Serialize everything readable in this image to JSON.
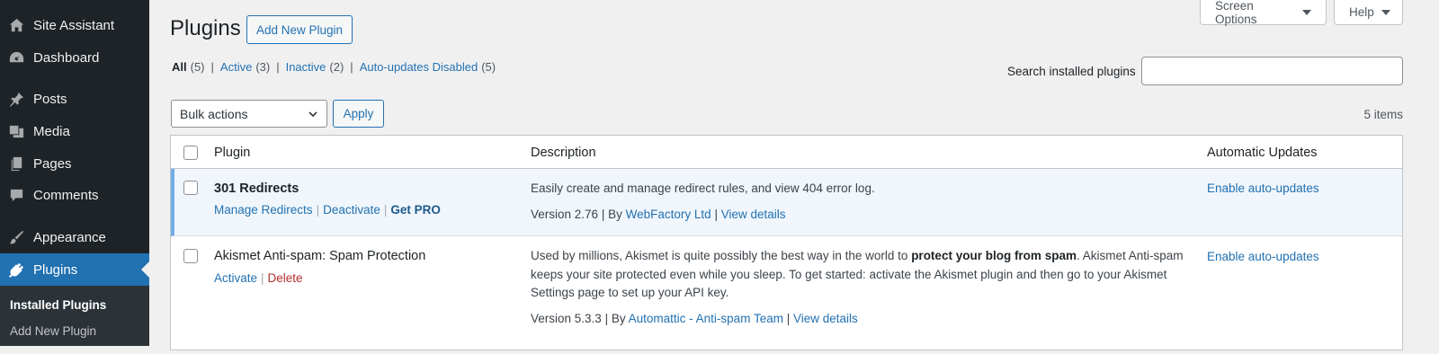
{
  "sidebar": {
    "items": [
      {
        "label": "Site Assistant",
        "icon": "house-icon"
      },
      {
        "label": "Dashboard",
        "icon": "dashboard-icon"
      },
      {
        "label": "Posts",
        "icon": "pushpin-icon"
      },
      {
        "label": "Media",
        "icon": "media-icon"
      },
      {
        "label": "Pages",
        "icon": "pages-icon"
      },
      {
        "label": "Comments",
        "icon": "comment-icon"
      },
      {
        "label": "Appearance",
        "icon": "brush-icon"
      },
      {
        "label": "Plugins",
        "icon": "plugin-icon"
      }
    ],
    "submenu": [
      "Installed Plugins",
      "Add New Plugin"
    ]
  },
  "header": {
    "title": "Plugins",
    "add_new": "Add New Plugin",
    "screen_options": "Screen Options",
    "help": "Help"
  },
  "filters": [
    {
      "label": "All",
      "count": "(5)"
    },
    {
      "label": "Active",
      "count": "(3)"
    },
    {
      "label": "Inactive",
      "count": "(2)"
    },
    {
      "label": "Auto-updates Disabled",
      "count": "(5)"
    }
  ],
  "search": {
    "label": "Search installed plugins",
    "value": ""
  },
  "bulk": {
    "selected": "Bulk actions",
    "apply": "Apply"
  },
  "items_count": "5 items",
  "table": {
    "headers": {
      "plugin": "Plugin",
      "description": "Description",
      "auto": "Automatic Updates"
    },
    "rows": [
      {
        "name": "301 Redirects",
        "actions": [
          "Manage Redirects",
          "Deactivate",
          "Get PRO"
        ],
        "description": "Easily create and manage redirect rules, and view 404 error log.",
        "version": "Version 2.76",
        "by": "By",
        "author": "WebFactory Ltd",
        "details": "View details",
        "auto": "Enable auto-updates"
      },
      {
        "name": "Akismet Anti-spam: Spam Protection",
        "actions": [
          "Activate",
          "Delete"
        ],
        "desc_pre": "Used by millions, Akismet is quite possibly the best way in the world to ",
        "desc_bold": "protect your blog from spam",
        "desc_post": ". Akismet Anti-spam keeps your site protected even while you sleep. To get started: activate the Akismet plugin and then go to your Akismet Settings page to set up your API key.",
        "version": "Version 5.3.3",
        "by": "By",
        "author": "Automattic - Anti-spam Team",
        "details": "View details",
        "auto": "Enable auto-updates"
      }
    ]
  },
  "colors": {
    "sidebar_bg": "#1d2327",
    "accent": "#2271b1",
    "active_row": "#f0f6fc",
    "delete": "#b32d2e"
  }
}
